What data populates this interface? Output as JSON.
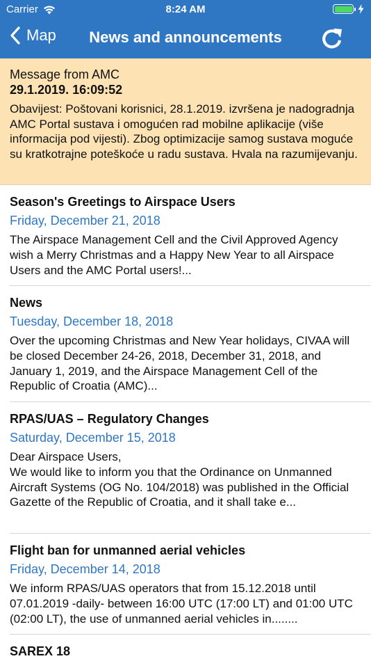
{
  "status_bar": {
    "carrier": "Carrier",
    "time": "8:24 AM"
  },
  "nav": {
    "back_label": "Map",
    "title": "News and announcements"
  },
  "message": {
    "title": "Message from AMC",
    "date": "29.1.2019. 16:09:52",
    "body": "Obavijest: Poštovani korisnici, 28.1.2019. izvršena je nadogradnja AMC Portal sustava i omogućen rad mobilne aplikacije (više informacija pod vijesti). Zbog optimizacije samog sustava moguće su kratkotrajne poteškoće u radu sustava. Hvala na razumijevanju."
  },
  "news": [
    {
      "title": "Season's Greetings to Airspace Users",
      "date": "Friday, December 21, 2018",
      "body": "The Airspace Management Cell and the Civil Approved Agency wish a Merry Christmas and a Happy New Year to all Airspace Users and the AMC Portal users!..."
    },
    {
      "title": "News",
      "date": "Tuesday, December 18, 2018",
      "body": "Over the upcoming Christmas and New Year holidays, CIVAA will be closed December 24-26, 2018, December 31, 2018, and January 1, 2019, and the Airspace Management Cell of the Republic of Croatia (AMC)..."
    },
    {
      "title": "RPAS/UAS – Regulatory Changes",
      "date": "Saturday, December 15, 2018",
      "body_line1": "Dear Airspace Users,",
      "body": "We would like to inform you that the Ordinance on Unmanned Aircraft Systems (OG No. 104/2018) was published in the Official Gazette of the Republic of Croatia, and it shall take e..."
    },
    {
      "title": "Flight ban for unmanned aerial vehicles",
      "date": "Friday, December 14, 2018",
      "body": "We inform RPAS/UAS operators that from 15.12.2018 until 07.01.2019 -daily- between 16:00 UTC (17:00 LT) and 01:00 UTC (02:00 LT), the use of unmanned aerial vehicles in........"
    },
    {
      "title": "SAREX 18"
    }
  ],
  "colors": {
    "nav_background": "#2f77c3",
    "message_background": "#fde3b4",
    "date_text": "#2f77c3",
    "battery_fill": "#4cd964"
  },
  "icons": {
    "wifi": "wifi-icon",
    "battery": "battery-icon",
    "charging": "charging-bolt-icon",
    "back": "chevron-left-icon",
    "refresh": "refresh-icon"
  }
}
